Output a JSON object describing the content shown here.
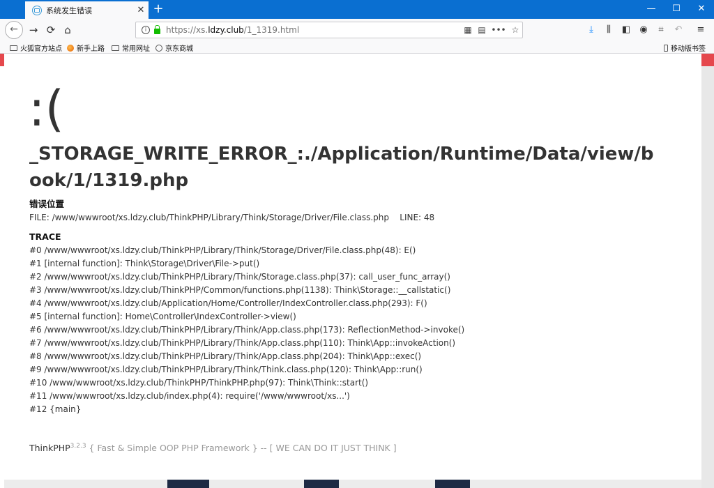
{
  "tab": {
    "title": "系统发生错误"
  },
  "window": {
    "minimize": "—",
    "maximize": "☐",
    "close": "✕"
  },
  "nav": {
    "back": "←",
    "forward": "→",
    "reload": "⟳",
    "home": "⌂"
  },
  "url": {
    "prefix": "https://xs.",
    "host": "ldzy.club",
    "path": "/1_1319.html"
  },
  "bookmarks": {
    "items": [
      "火狐官方站点",
      "新手上路",
      "常用网址",
      "京东商城"
    ],
    "mobile": "移动版书签"
  },
  "error": {
    "face": ":(",
    "title": "_STORAGE_WRITE_ERROR_:./Application/Runtime/Data/view/book/1/1319.php",
    "location_heading": "错误位置",
    "file_line": "FILE: /www/wwwroot/xs.ldzy.club/ThinkPHP/Library/Think/Storage/Driver/File.class.php    LINE: 48",
    "trace_heading": "TRACE",
    "trace": [
      "#0 /www/wwwroot/xs.ldzy.club/ThinkPHP/Library/Think/Storage/Driver/File.class.php(48): E()",
      "#1 [internal function]: Think\\Storage\\Driver\\File->put()",
      "#2 /www/wwwroot/xs.ldzy.club/ThinkPHP/Library/Think/Storage.class.php(37): call_user_func_array()",
      "#3 /www/wwwroot/xs.ldzy.club/ThinkPHP/Common/functions.php(1138): Think\\Storage::__callstatic()",
      "#4 /www/wwwroot/xs.ldzy.club/Application/Home/Controller/IndexController.class.php(293): F()",
      "#5 [internal function]: Home\\Controller\\IndexController->view()",
      "#6 /www/wwwroot/xs.ldzy.club/ThinkPHP/Library/Think/App.class.php(173): ReflectionMethod->invoke()",
      "#7 /www/wwwroot/xs.ldzy.club/ThinkPHP/Library/Think/App.class.php(110): Think\\App::invokeAction()",
      "#8 /www/wwwroot/xs.ldzy.club/ThinkPHP/Library/Think/App.class.php(204): Think\\App::exec()",
      "#9 /www/wwwroot/xs.ldzy.club/ThinkPHP/Library/Think/Think.class.php(120): Think\\App::run()",
      "#10 /www/wwwroot/xs.ldzy.club/ThinkPHP/ThinkPHP.php(97): Think\\Think::start()",
      "#11 /www/wwwroot/xs.ldzy.club/index.php(4): require('/www/wwwroot/xs...')",
      "#12 {main}"
    ]
  },
  "footer": {
    "brand": "ThinkPHP",
    "version": "3.2.3",
    "slogan": " { Fast & Simple OOP PHP Framework } -- [ WE CAN DO IT JUST THINK ]"
  }
}
